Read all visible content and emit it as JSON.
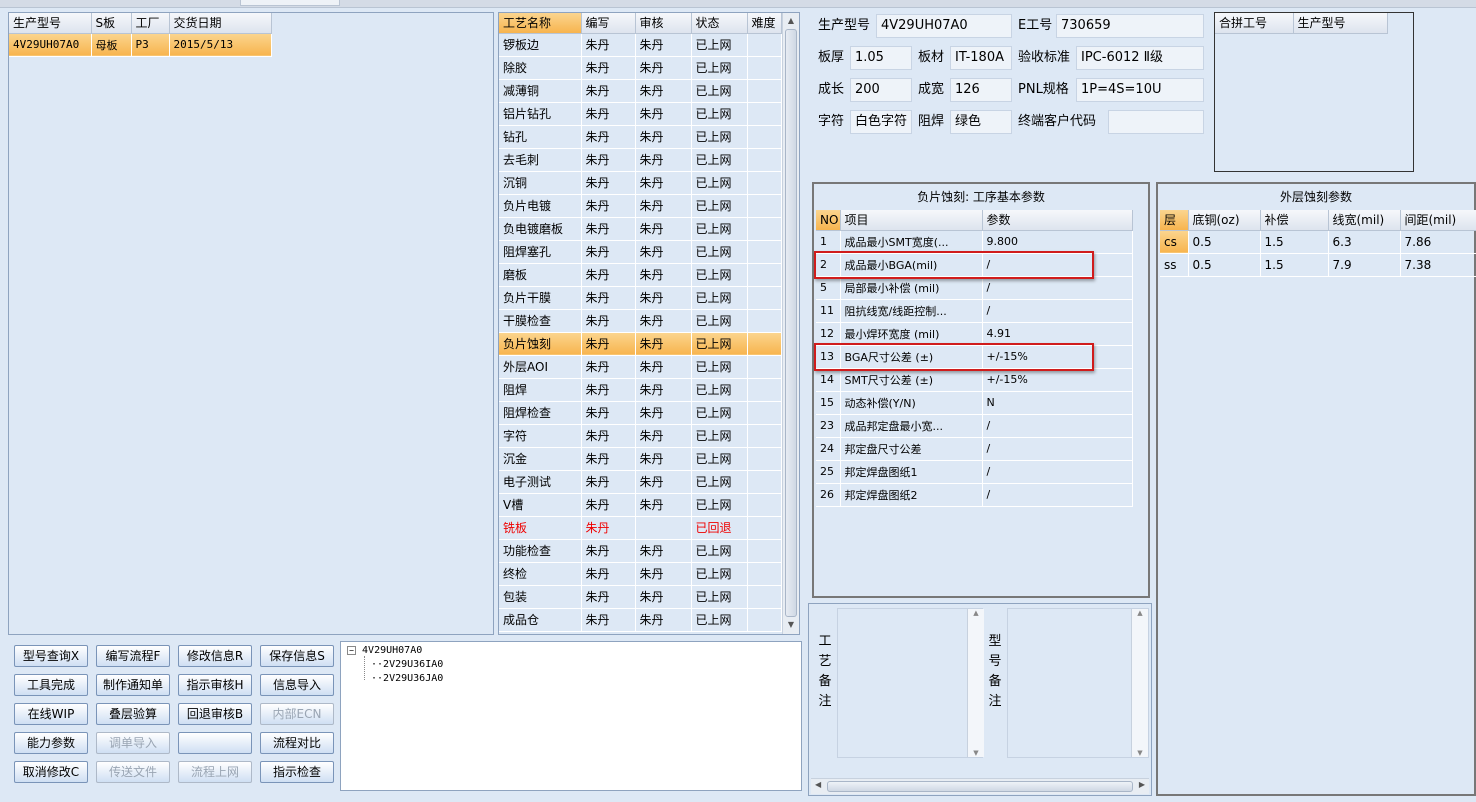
{
  "toolbar_strip": {
    "label": ""
  },
  "orders": {
    "headers": [
      "生产型号",
      "S板",
      "工厂",
      "交货日期"
    ],
    "rows": [
      [
        "4V29UH07A0",
        "母板",
        "P3",
        "2015/5/13"
      ]
    ]
  },
  "process": {
    "headers": [
      "工艺名称",
      "编写",
      "审核",
      "状态",
      "难度"
    ],
    "rows": [
      [
        "锣板边",
        "朱丹",
        "朱丹",
        "已上网",
        ""
      ],
      [
        "除胶",
        "朱丹",
        "朱丹",
        "已上网",
        ""
      ],
      [
        "减薄铜",
        "朱丹",
        "朱丹",
        "已上网",
        ""
      ],
      [
        "铝片钻孔",
        "朱丹",
        "朱丹",
        "已上网",
        ""
      ],
      [
        "钻孔",
        "朱丹",
        "朱丹",
        "已上网",
        ""
      ],
      [
        "去毛刺",
        "朱丹",
        "朱丹",
        "已上网",
        ""
      ],
      [
        "沉铜",
        "朱丹",
        "朱丹",
        "已上网",
        ""
      ],
      [
        "负片电镀",
        "朱丹",
        "朱丹",
        "已上网",
        ""
      ],
      [
        "负电镀磨板",
        "朱丹",
        "朱丹",
        "已上网",
        ""
      ],
      [
        "阻焊塞孔",
        "朱丹",
        "朱丹",
        "已上网",
        ""
      ],
      [
        "磨板",
        "朱丹",
        "朱丹",
        "已上网",
        ""
      ],
      [
        "负片干膜",
        "朱丹",
        "朱丹",
        "已上网",
        ""
      ],
      [
        "干膜检查",
        "朱丹",
        "朱丹",
        "已上网",
        ""
      ],
      [
        "负片蚀刻",
        "朱丹",
        "朱丹",
        "已上网",
        ""
      ],
      [
        "外层AOI",
        "朱丹",
        "朱丹",
        "已上网",
        ""
      ],
      [
        "阻焊",
        "朱丹",
        "朱丹",
        "已上网",
        ""
      ],
      [
        "阻焊检查",
        "朱丹",
        "朱丹",
        "已上网",
        ""
      ],
      [
        "字符",
        "朱丹",
        "朱丹",
        "已上网",
        ""
      ],
      [
        "沉金",
        "朱丹",
        "朱丹",
        "已上网",
        ""
      ],
      [
        "电子测试",
        "朱丹",
        "朱丹",
        "已上网",
        ""
      ],
      [
        "V槽",
        "朱丹",
        "朱丹",
        "已上网",
        ""
      ],
      [
        "铣板",
        "朱丹",
        "",
        "已回退",
        ""
      ],
      [
        "功能检查",
        "朱丹",
        "朱丹",
        "已上网",
        ""
      ],
      [
        "终检",
        "朱丹",
        "朱丹",
        "已上网",
        ""
      ],
      [
        "包装",
        "朱丹",
        "朱丹",
        "已上网",
        ""
      ],
      [
        "成品仓",
        "朱丹",
        "朱丹",
        "已上网",
        ""
      ]
    ]
  },
  "info": {
    "model_label": "生产型号",
    "model_value": "4V29UH07A0",
    "eno_label": "E工号",
    "eno_value": "730659",
    "thick_label": "板厚",
    "thick_value": "1.05",
    "material_label": "板材",
    "material_value": "IT-180A",
    "standard_label": "验收标准",
    "standard_value": "IPC-6012 Ⅱ级",
    "length_label": "成长",
    "length_value": "200",
    "width_label": "成宽",
    "width_value": "126",
    "pnl_label": "PNL规格",
    "pnl_value": "1P=4S=10U",
    "char_label": "字符",
    "char_value": "白色字符",
    "mask_label": "阻焊",
    "mask_value": "绿色",
    "customer_label": "终端客户代码",
    "customer_value": ""
  },
  "merge": {
    "headers": [
      "合拼工号",
      "生产型号"
    ]
  },
  "params": {
    "title": "负片蚀刻: 工序基本参数",
    "headers": [
      "NO",
      "项目",
      "参数"
    ],
    "rows": [
      [
        "1",
        "成品最小SMT宽度(...",
        "9.800"
      ],
      [
        "2",
        "成品最小BGA(mil)",
        "/"
      ],
      [
        "5",
        "局部最小补偿 (mil)",
        "/"
      ],
      [
        "11",
        "阻抗线宽/线距控制...",
        "/"
      ],
      [
        "12",
        "最小焊环宽度 (mil)",
        "4.91"
      ],
      [
        "13",
        "BGA尺寸公差 (±)",
        "+/-15%"
      ],
      [
        "14",
        "SMT尺寸公差 (±)",
        "+/-15%"
      ],
      [
        "15",
        "动态补偿(Y/N)",
        "N"
      ],
      [
        "23",
        "成品邦定盘最小宽...",
        "/"
      ],
      [
        "24",
        "邦定盘尺寸公差",
        "/"
      ],
      [
        "25",
        "邦定焊盘图纸1",
        "/"
      ],
      [
        "26",
        "邦定焊盘图纸2",
        "/"
      ]
    ]
  },
  "outer": {
    "title": "外层蚀刻参数",
    "headers": [
      "层",
      "底铜(oz)",
      "补偿",
      "线宽(mil)",
      "间距(mil)"
    ],
    "rows": [
      [
        "cs",
        "0.5",
        "1.5",
        "6.3",
        "7.86"
      ],
      [
        "ss",
        "0.5",
        "1.5",
        "7.9",
        "7.38"
      ]
    ]
  },
  "notes": {
    "process_label": "工艺备注",
    "model_label": "型号备注"
  },
  "tree": {
    "root": "4V29UH07A0",
    "children": [
      "2V29U36IA0",
      "2V29U36JA0"
    ]
  },
  "buttons": [
    [
      "型号查询X",
      "编写流程F",
      "修改信息R",
      "保存信息S"
    ],
    [
      "工具完成",
      "制作通知单",
      "指示审核H",
      "信息导入"
    ],
    [
      "在线WIP",
      "叠层验算",
      "回退审核B",
      "内部ECN"
    ],
    [
      "能力参数",
      "调单导入",
      "",
      "流程对比"
    ],
    [
      "取消修改C",
      "传送文件",
      "流程上网",
      "指示检查"
    ]
  ],
  "disabled_buttons": [
    "内部ECN",
    "调单导入",
    "传送文件",
    "流程上网"
  ]
}
